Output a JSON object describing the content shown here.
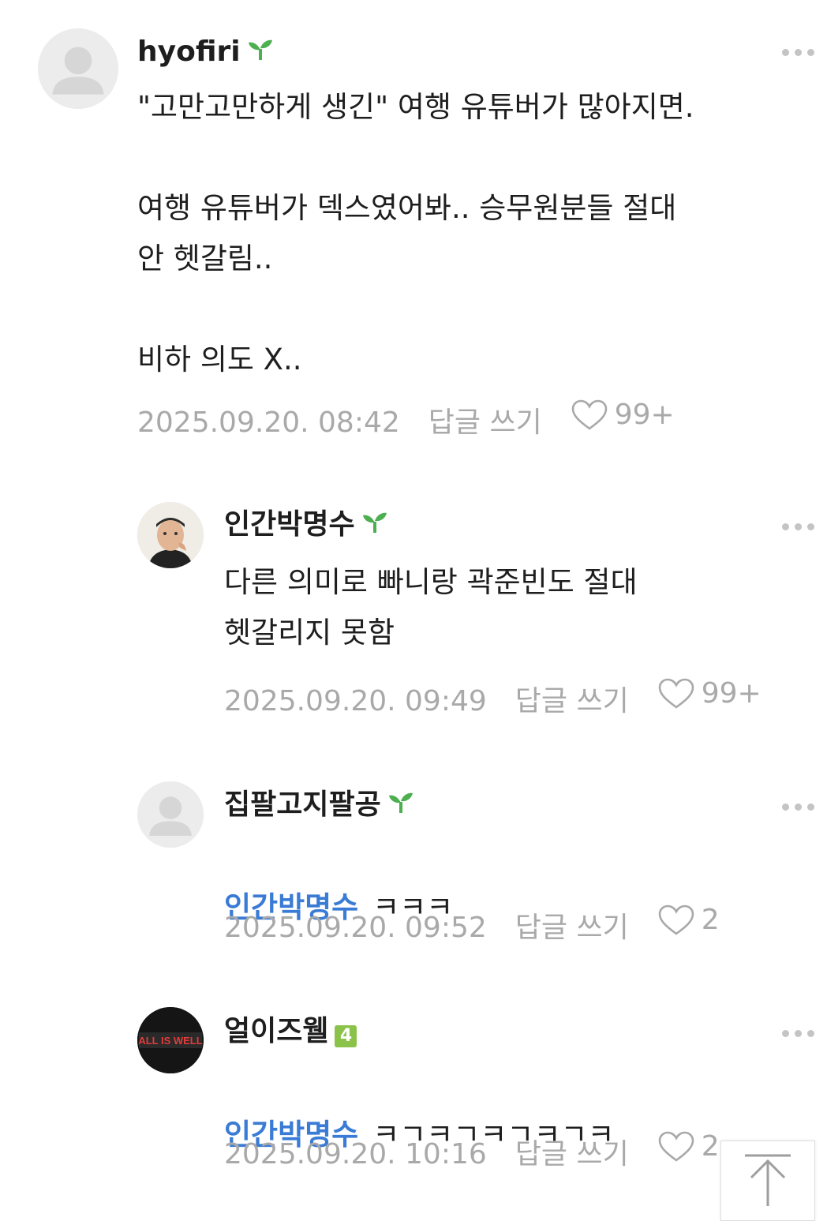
{
  "comments": [
    {
      "author": "hyofiri",
      "badge": "sprout-icon",
      "mention": "",
      "text": "\"고만고만하게 생긴\" 여행 유튜버가 많아지면.\n\n여행 유튜버가 덱스였어봐.. 승무원분들 절대\n안 헷갈림..\n\n비하 의도 X..",
      "date": "2025.09.20. 08:42",
      "reply_label": "답글 쓰기",
      "likes": "99+"
    },
    {
      "author": "인간박명수",
      "badge": "sprout-icon",
      "mention": "",
      "text": "다른 의미로 빠니랑 곽준빈도 절대\n헷갈리지 못함",
      "date": "2025.09.20. 09:49",
      "reply_label": "답글 쓰기",
      "likes": "99+"
    },
    {
      "author": "집팔고지팔공",
      "badge": "sprout-icon",
      "mention": "인간박명수",
      "text": "ㅋㅋㅋ",
      "date": "2025.09.20. 09:52",
      "reply_label": "답글 쓰기",
      "likes": "2"
    },
    {
      "author": "얼이즈웰",
      "badge": "level-4-icon",
      "badge_label": "4",
      "avatar_text": "ALL IS WELL",
      "mention": "인간박명수",
      "text": "ㅋㄱㅋㄱㅋㄱㅋㄱㅋ",
      "date": "2025.09.20. 10:16",
      "reply_label": "답글 쓰기",
      "likes": "2"
    }
  ],
  "colors": {
    "mention": "#3a7bd5",
    "meta": "#a9a9a9",
    "sprout": "#4caf50"
  }
}
